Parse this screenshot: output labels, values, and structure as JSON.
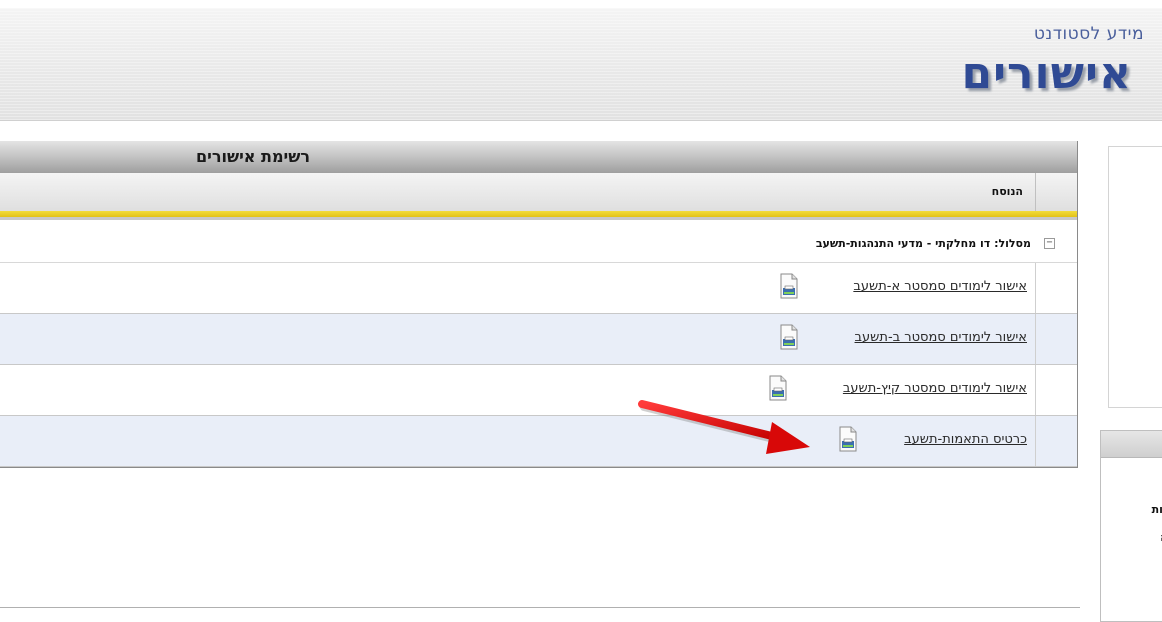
{
  "header": {
    "subtitle": "מידע לסטודנט",
    "title": "אישורים"
  },
  "panel": {
    "title": "רשימת אישורים",
    "column_header": "הנוסח",
    "group": {
      "toggle_symbol": "−",
      "label": "מסלול: דו מחלקתי - מדעי התנהגות-תשעב"
    },
    "rows": [
      {
        "label": "אישור לימודים סמסטר א-תשעב",
        "icon": "document-print-icon"
      },
      {
        "label": "אישור לימודים סמסטר ב-תשעב",
        "icon": "document-print-icon"
      },
      {
        "label": "אישור לימודים סמסטר קיץ-תשעב",
        "icon": "document-print-icon"
      },
      {
        "label": "כרטיס התאמות-תשעב",
        "icon": "document-print-icon"
      }
    ]
  },
  "side_panel": {
    "lines": [
      "קות",
      ":",
      "יה",
      "ת"
    ]
  },
  "colors": {
    "title_blue": "#2f4a94",
    "highlight_bar": "#e2c216",
    "alt_row": "#e9eef8",
    "annotation_arrow": "#e01010"
  }
}
